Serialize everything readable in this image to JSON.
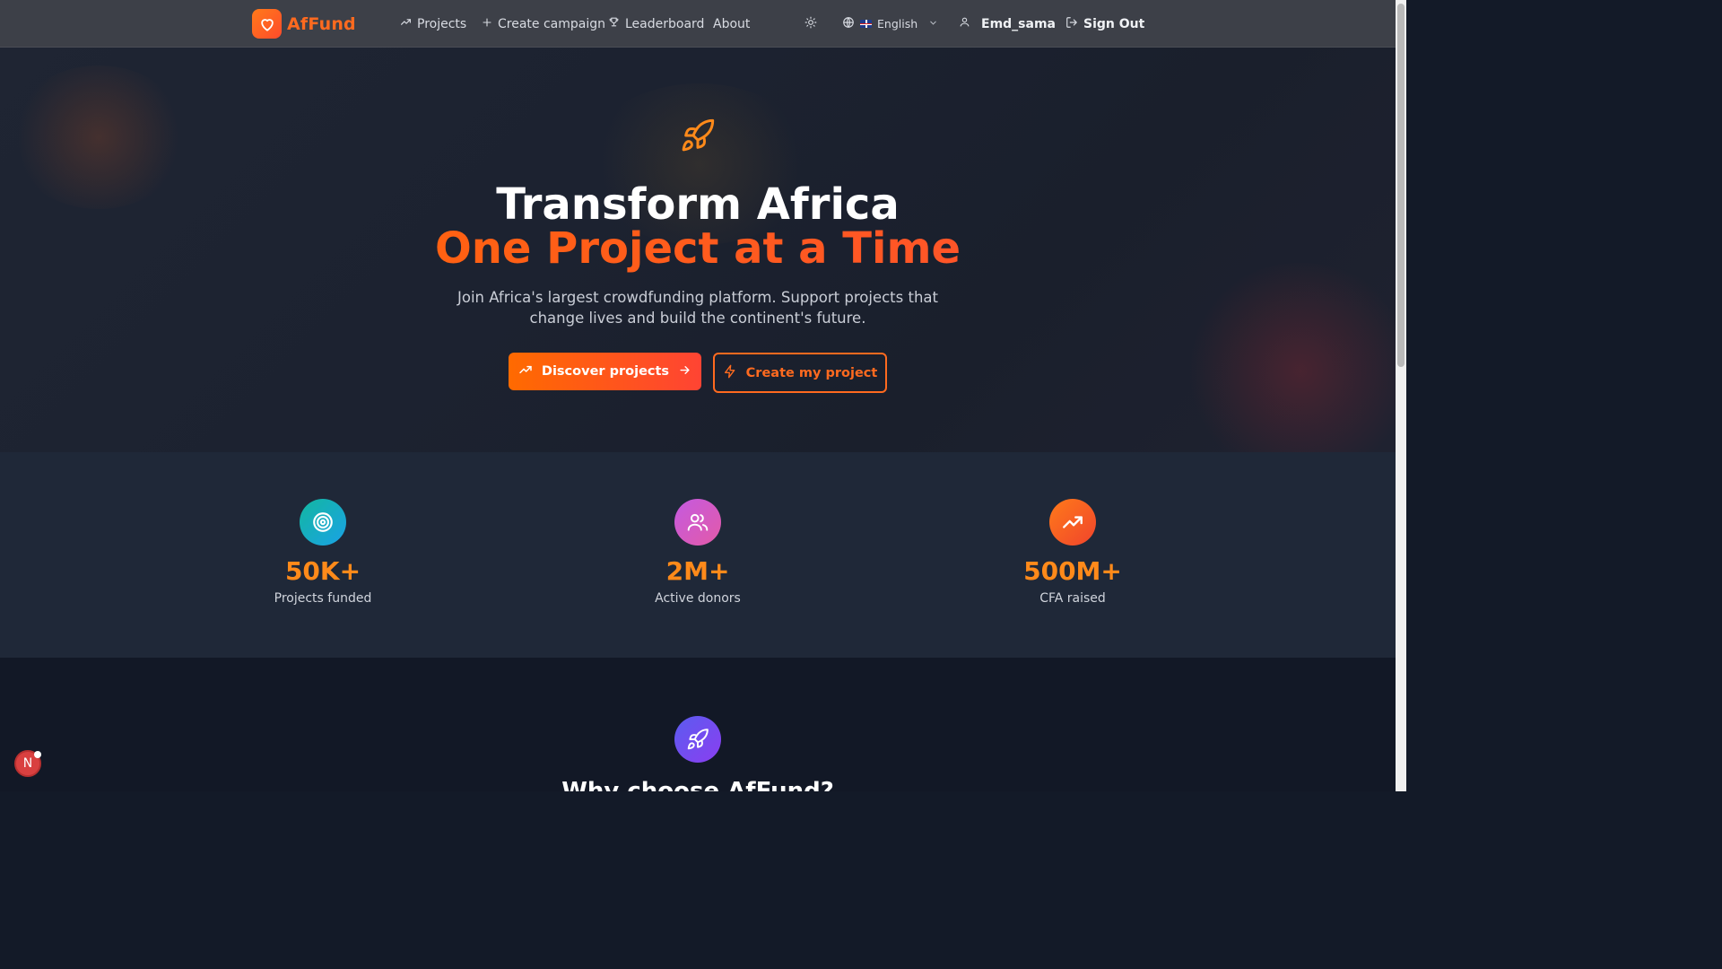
{
  "nav": {
    "brand": "AfFund",
    "links": [
      "Projects",
      "Create campaign",
      "Leaderboard",
      "About"
    ],
    "language": "English",
    "username": "Emd_sama",
    "sign_out": "Sign Out"
  },
  "hero": {
    "title_line1": "Transform Africa",
    "title_line2": "One Project at a Time",
    "subtitle": "Join Africa's largest crowdfunding platform. Support projects that change lives and build the continent's future.",
    "primary_button": "Discover projects",
    "secondary_button": "Create my project"
  },
  "stats": [
    {
      "value": "50K+",
      "label": "Projects funded",
      "icon": "target-icon"
    },
    {
      "value": "2M+",
      "label": "Active donors",
      "icon": "users-icon"
    },
    {
      "value": "500M+",
      "label": "CFA raised",
      "icon": "trending-up-icon"
    }
  ],
  "why": {
    "title": "Why choose AfFund?"
  },
  "floating_badge": "N",
  "colors": {
    "accent": "#ff6a1f",
    "nav_bg": "#3d4048",
    "hero_bg": "#1c2230",
    "stats_bg": "#1f2838"
  }
}
